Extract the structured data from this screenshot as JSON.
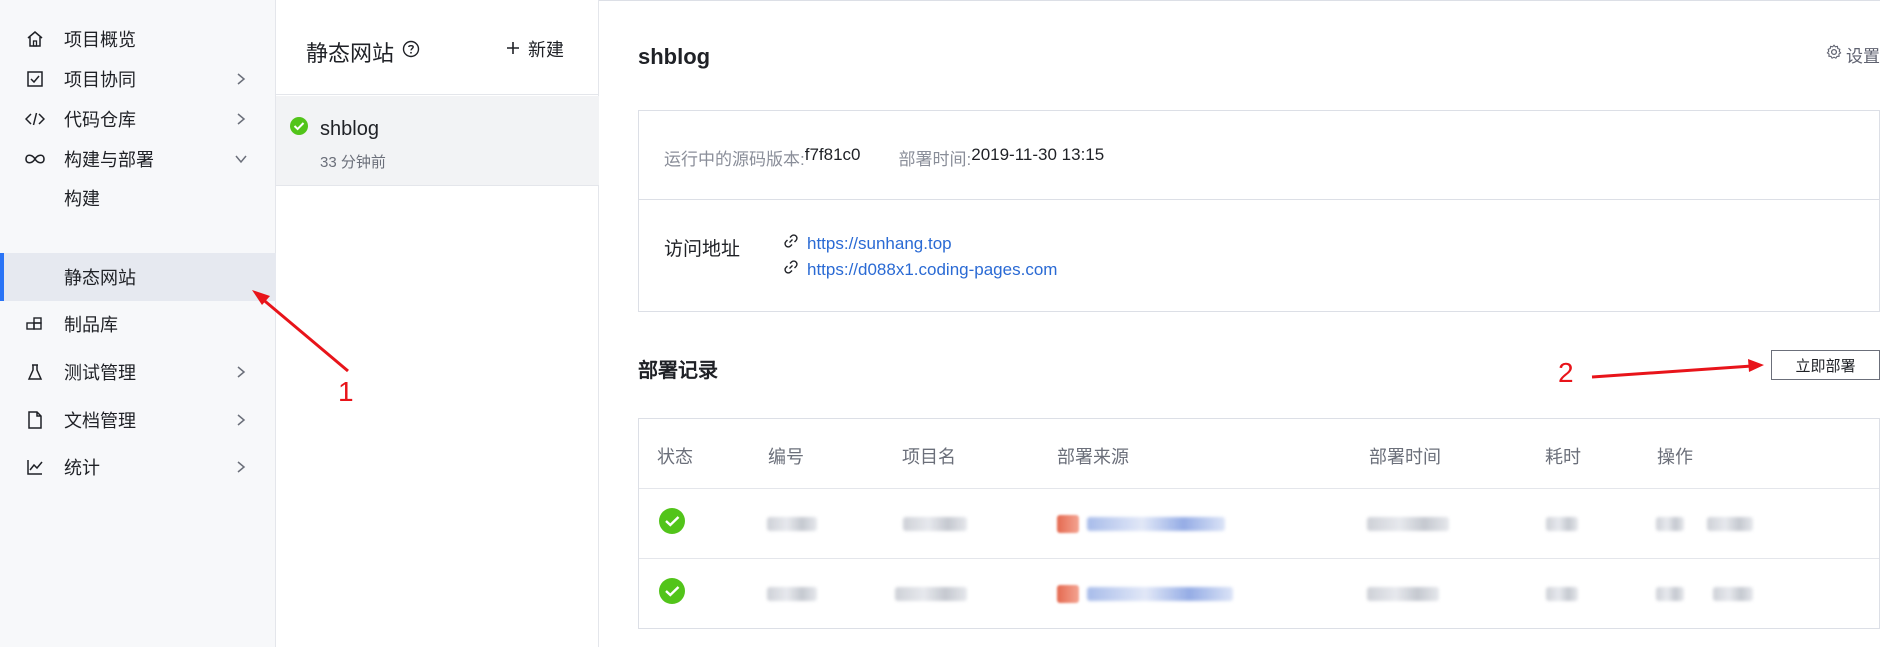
{
  "nav": {
    "items": [
      {
        "label": "项目概览",
        "icon": "home-icon"
      },
      {
        "label": "项目协同",
        "icon": "checkbox-icon"
      },
      {
        "label": "代码仓库",
        "icon": "code-icon"
      },
      {
        "label": "构建与部署",
        "icon": "infinity-icon"
      },
      {
        "label": "构建",
        "icon": ""
      },
      {
        "label": "静态网站",
        "icon": ""
      },
      {
        "label": "制品库",
        "icon": "boxes-icon"
      },
      {
        "label": "测试管理",
        "icon": "flask-icon"
      },
      {
        "label": "文档管理",
        "icon": "document-icon"
      },
      {
        "label": "统计",
        "icon": "chart-icon"
      }
    ],
    "active": "静态网站"
  },
  "sites": {
    "title": "静态网站",
    "new_label": "新建",
    "list": [
      {
        "name": "shblog",
        "time": "33 分钟前",
        "status": "success"
      }
    ]
  },
  "detail": {
    "title": "shblog",
    "settings_label": "设置",
    "version_label": "运行中的源码版本:",
    "version_value": "f7f81c0",
    "deploy_time_label": "部署时间:",
    "deploy_time_value": "2019-11-30 13:15",
    "address_label": "访问地址",
    "links": [
      "https://sunhang.top",
      "https://d088x1.coding-pages.com"
    ],
    "records_title": "部署记录",
    "deploy_now_label": "立即部署"
  },
  "table": {
    "headers": [
      "状态",
      "编号",
      "项目名",
      "部署来源",
      "部署时间",
      "耗时",
      "操作"
    ],
    "rows": [
      {
        "status": "success"
      },
      {
        "status": "success"
      }
    ]
  },
  "annotations": {
    "one": "1",
    "two": "2"
  },
  "colors": {
    "accent": "#2a74f6",
    "success": "#52c41a",
    "annotation": "#e8141a",
    "link": "#2a6ad4"
  }
}
